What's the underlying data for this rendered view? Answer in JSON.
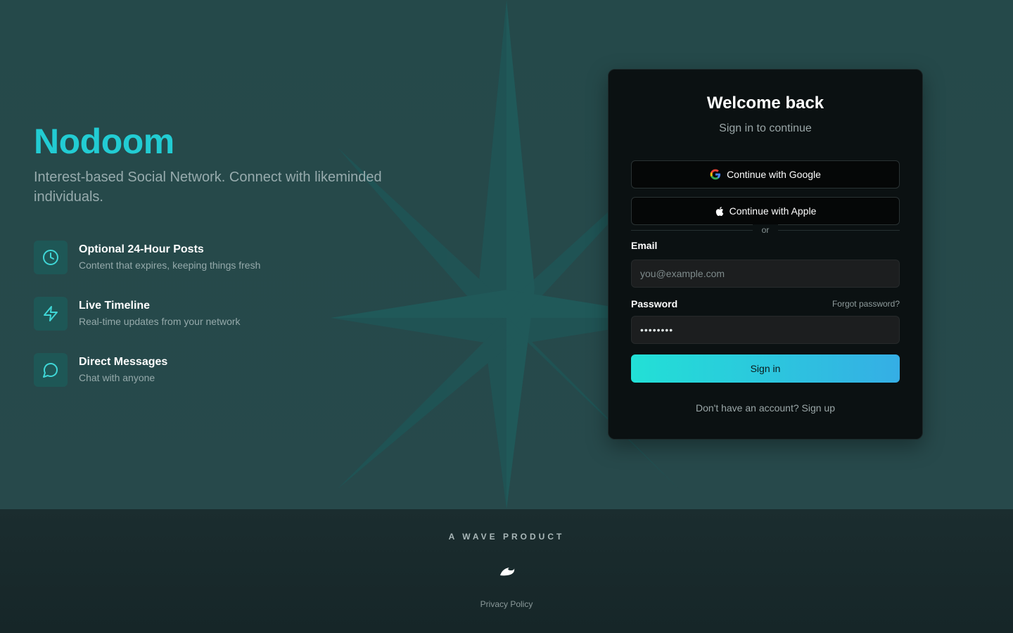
{
  "brand": {
    "name": "Nodoom",
    "tagline": "Interest-based Social Network. Connect with likeminded individuals."
  },
  "features": [
    {
      "icon": "clock-icon",
      "title": "Optional 24-Hour Posts",
      "description": "Content that expires, keeping things fresh"
    },
    {
      "icon": "lightning-icon",
      "title": "Live Timeline",
      "description": "Real-time updates from your network"
    },
    {
      "icon": "message-icon",
      "title": "Direct Messages",
      "description": "Chat with anyone"
    }
  ],
  "login": {
    "title": "Welcome back",
    "subtitle": "Sign in to continue",
    "google_label": "Continue with Google",
    "apple_label": "Continue with Apple",
    "divider": "or",
    "email_label": "Email",
    "email_placeholder": "you@example.com",
    "password_label": "Password",
    "forgot_label": "Forgot password?",
    "password_value": "••••••••",
    "submit_label": "Sign in",
    "signup_text": "Don't have an account? Sign up"
  },
  "footer": {
    "product_label": "A WAVE PRODUCT",
    "logo_icon": "wave-logo-icon",
    "privacy_label": "Privacy Policy"
  },
  "colors": {
    "brand": "#22ccd3",
    "background": "#264849",
    "card": "#0b1112",
    "button_gradient_start": "#22e0d6",
    "button_gradient_end": "#35aee5"
  }
}
